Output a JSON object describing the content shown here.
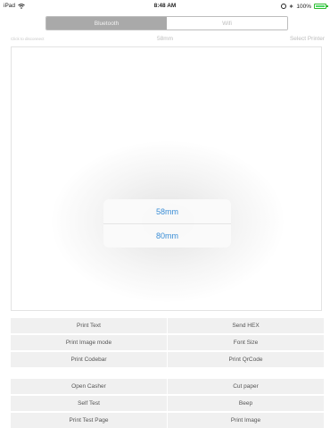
{
  "status_bar": {
    "device": "iPad",
    "time": "8:48 AM",
    "battery": "100%",
    "battery_level": 1.0,
    "icons": [
      "wifi-icon",
      "alarm-icon",
      "bluetooth-icon",
      "battery-icon"
    ]
  },
  "connection_tabs": [
    {
      "label": "Bluetooth",
      "selected": true
    },
    {
      "label": "Wifi",
      "selected": false
    }
  ],
  "top_bar": {
    "disconnect": "Click to disconnect",
    "paper_size": "58mm",
    "select_printer": "Select Printer"
  },
  "paper_picker": {
    "options": [
      "58mm",
      "80mm"
    ]
  },
  "actions_group1": [
    "Print Text",
    "Send HEX",
    "Print Image mode",
    "Font Size",
    "Print Codebar",
    "Print QrCode"
  ],
  "actions_group2": [
    "Open Casher",
    "Cut paper",
    "Self Test",
    "Beep",
    "Print Test Page",
    "Print Image"
  ],
  "colors": {
    "accent": "#3b8ed6",
    "segment_active": "#a9a9a9",
    "button_bg": "#f0f0f0",
    "battery": "#4cd964"
  }
}
